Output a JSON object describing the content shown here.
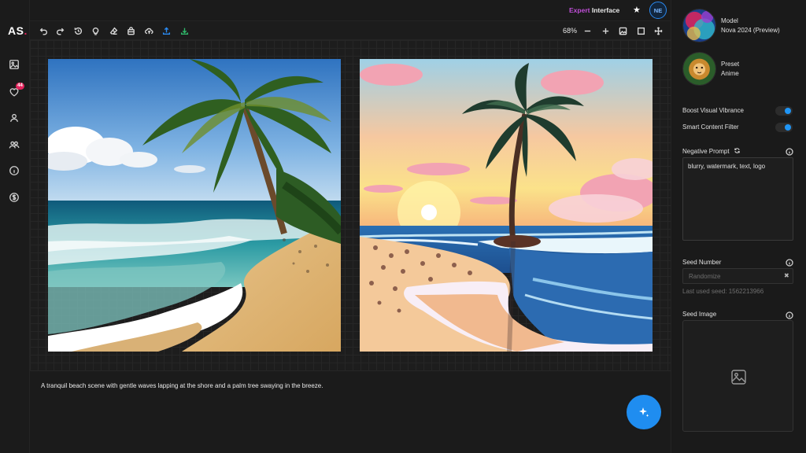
{
  "app": {
    "logo": "AS",
    "logo_dot": "."
  },
  "header": {
    "mode_prefix": "Expert",
    "mode_suffix": "Interface",
    "star_icon": "star-icon",
    "avatar_initials": "NE"
  },
  "sidebar": {
    "items": [
      {
        "name": "image-icon"
      },
      {
        "name": "heart-icon",
        "badge": "44"
      },
      {
        "name": "user-icon"
      },
      {
        "name": "users-icon"
      },
      {
        "name": "info-icon"
      },
      {
        "name": "dollar-icon"
      }
    ]
  },
  "toolbar": {
    "left_icons": [
      "undo-icon",
      "redo-icon",
      "history-icon",
      "bulb-icon",
      "eraser-icon",
      "bag-icon",
      "cloud-upload-icon",
      "upload-icon",
      "download-icon"
    ],
    "zoom": "68%",
    "right_icons": [
      "zoom-out-icon",
      "zoom-in-icon",
      "image-icon",
      "frame-icon",
      "move-icon"
    ]
  },
  "canvas": {
    "images": [
      {
        "name": "realistic-beach-image"
      },
      {
        "name": "anime-beach-image"
      }
    ]
  },
  "prompt": {
    "text": "A tranquil beach scene with gentle waves lapping at the shore and a palm tree swaying in the breeze."
  },
  "right_panel": {
    "model": {
      "label": "Model",
      "value": "Nova 2024 (Preview)"
    },
    "preset": {
      "label": "Preset",
      "value": "Anime"
    },
    "toggles": [
      {
        "label": "Boost Visual Vibrance",
        "on": true
      },
      {
        "label": "Smart Content Filter",
        "on": true
      }
    ],
    "negative_prompt": {
      "label": "Negative Prompt",
      "value": "blurry, watermark, text, logo"
    },
    "seed_number": {
      "label": "Seed Number",
      "placeholder": "Randomize",
      "last_used": "Last used seed: 1562213966"
    },
    "seed_image": {
      "label": "Seed Image"
    }
  },
  "colors": {
    "accent": "#1f8df0",
    "badge": "#e2245c",
    "mode_prefix": "#c04fd8",
    "toggle_on": "#1f95f5",
    "upload_blue": "#2a8af2",
    "download_green": "#2fb86a"
  }
}
